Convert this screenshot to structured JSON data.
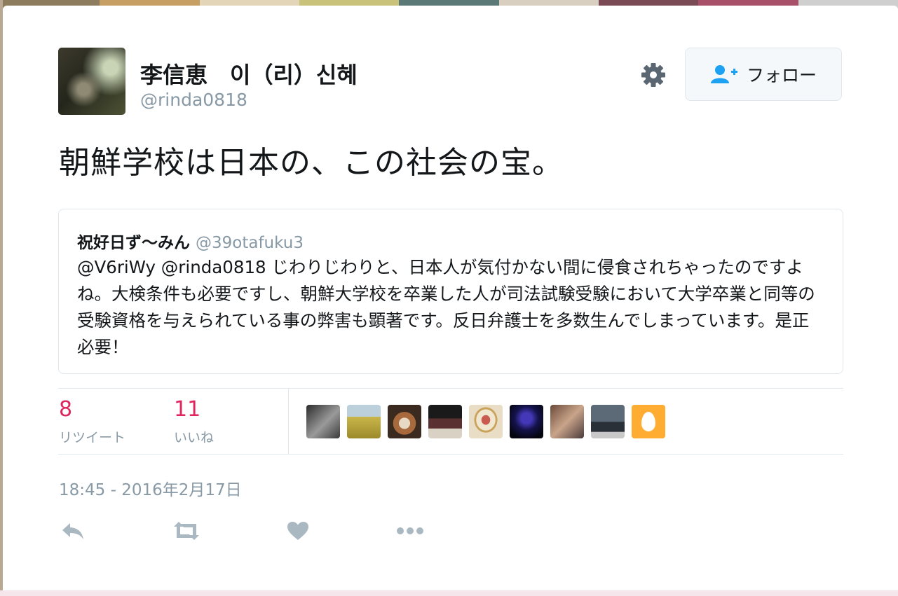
{
  "colors": {
    "text": "#14171a",
    "secondary": "#8899a6",
    "count": "#e0245e",
    "border": "#e1e8ed",
    "follow_icon": "#1da1f2",
    "action_icon": "#aab8c2"
  },
  "tweet": {
    "author_name": "李信恵　이（리）신혜",
    "author_handle": "@rinda0818",
    "follow_label": "フォロー",
    "follow_icon": "add-user-icon",
    "settings_icon": "gear-icon",
    "text": "朝鮮学校は日本の、この社会の宝。"
  },
  "quoted": {
    "name": "祝好日ず〜みん",
    "handle": "@39otafuku3",
    "text": "@V6riWy @rinda0818 じわりじわりと、日本人が気付かない間に侵食されちゃったのですよね。大検条件も必要ですし、朝鮮大学校を卒業した人が司法試験受験において大学卒業と同等の受験資格を与えられている事の弊害も顕著です。反日弁護士を多数生んでしまっています。是正必要！"
  },
  "stats": {
    "retweets": {
      "count": "8",
      "label": "リツイート"
    },
    "likes": {
      "count": "11",
      "label": "いいね"
    }
  },
  "favoriters": [
    {
      "name": "favoriter-1"
    },
    {
      "name": "favoriter-2"
    },
    {
      "name": "favoriter-3"
    },
    {
      "name": "favoriter-4"
    },
    {
      "name": "favoriter-5"
    },
    {
      "name": "favoriter-6"
    },
    {
      "name": "favoriter-7"
    },
    {
      "name": "favoriter-8"
    },
    {
      "name": "favoriter-9",
      "icon": "egg-icon"
    }
  ],
  "timestamp": "18:45 - 2016年2月17日",
  "actions": [
    "reply-icon",
    "retweet-icon",
    "heart-icon",
    "more-icon"
  ]
}
